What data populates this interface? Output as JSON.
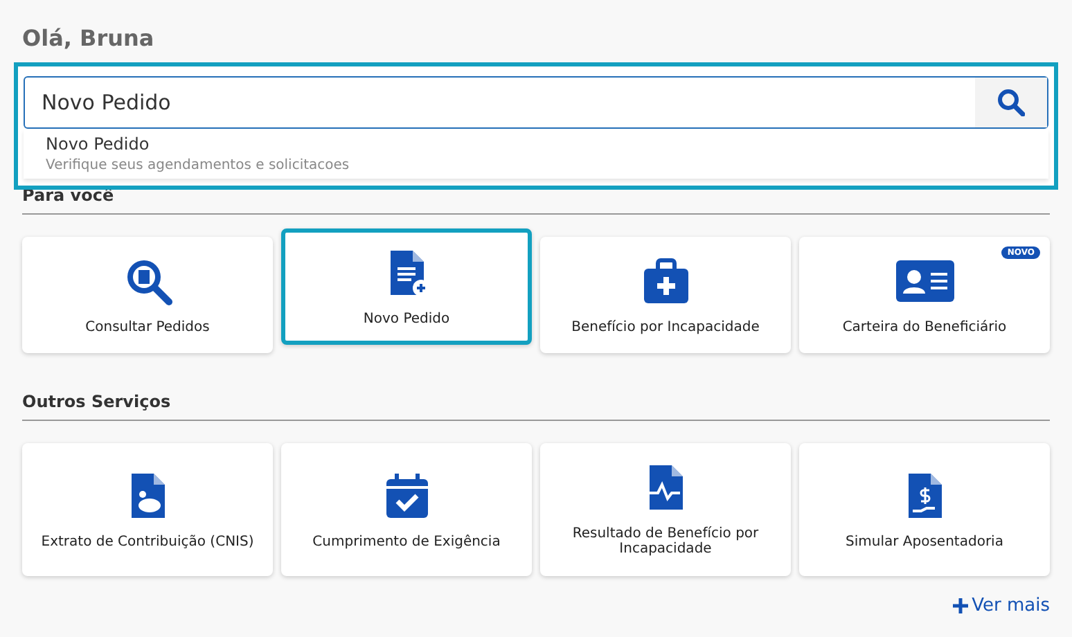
{
  "greeting": "Olá, Bruna",
  "search": {
    "value": "Novo Pedido",
    "suggestions": [
      {
        "title": "Novo Pedido",
        "subtitle": "Verifique seus agendamentos e solicitacoes"
      }
    ]
  },
  "sections": [
    {
      "title": "Para você",
      "cards": [
        {
          "kind": "search",
          "label": "Consultar Pedidos",
          "selected": false
        },
        {
          "kind": "new-doc",
          "label": "Novo Pedido",
          "selected": true
        },
        {
          "kind": "medkit",
          "label": "Benefício por Incapacidade",
          "selected": false
        },
        {
          "kind": "id-card",
          "label": "Carteira do Beneficiário",
          "selected": false,
          "badge": "NOVO"
        }
      ]
    },
    {
      "title": "Outros Serviços",
      "cards": [
        {
          "kind": "piggy-doc",
          "label": "Extrato de Contribuição (CNIS)",
          "selected": false
        },
        {
          "kind": "calendar",
          "label": "Cumprimento de Exigência",
          "selected": false
        },
        {
          "kind": "pulse-doc",
          "label": "Resultado de Benefício por Incapacidade",
          "selected": false
        },
        {
          "kind": "money-doc",
          "label": "Simular Aposentadoria",
          "selected": false
        }
      ]
    }
  ],
  "more_link": "Ver mais"
}
